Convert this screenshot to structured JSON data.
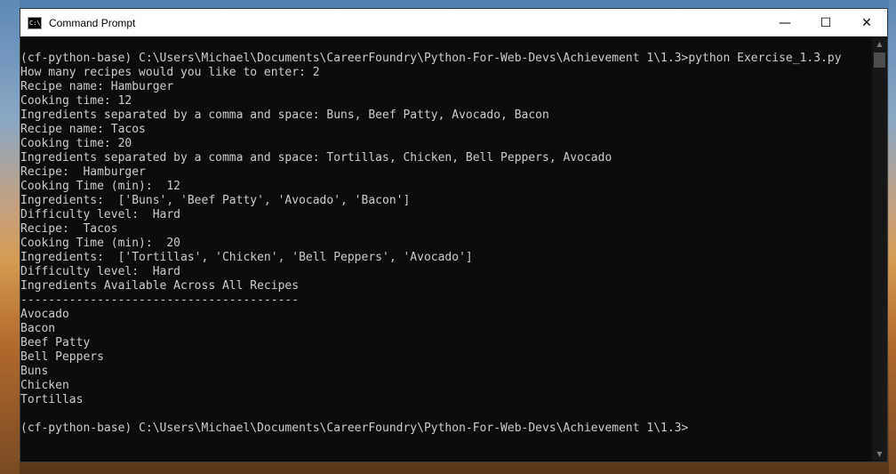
{
  "window": {
    "title": "Command Prompt",
    "icon_text": "C:\\",
    "icon": "console-app-icon",
    "controls": {
      "minimize": "—",
      "maximize": "☐",
      "close": "✕"
    }
  },
  "console": {
    "lines": [
      "(cf-python-base) C:\\Users\\Michael\\Documents\\CareerFoundry\\Python-For-Web-Devs\\Achievement 1\\1.3>python Exercise_1.3.py",
      "How many recipes would you like to enter: 2",
      "Recipe name: Hamburger",
      "Cooking time: 12",
      "Ingredients separated by a comma and space: Buns, Beef Patty, Avocado, Bacon",
      "Recipe name: Tacos",
      "Cooking time: 20",
      "Ingredients separated by a comma and space: Tortillas, Chicken, Bell Peppers, Avocado",
      "Recipe:  Hamburger",
      "Cooking Time (min):  12",
      "Ingredients:  ['Buns', 'Beef Patty', 'Avocado', 'Bacon']",
      "Difficulty level:  Hard",
      "Recipe:  Tacos",
      "Cooking Time (min):  20",
      "Ingredients:  ['Tortillas', 'Chicken', 'Bell Peppers', 'Avocado']",
      "Difficulty level:  Hard",
      "Ingredients Available Across All Recipes",
      "----------------------------------------",
      "Avocado",
      "Bacon",
      "Beef Patty",
      "Bell Peppers",
      "Buns",
      "Chicken",
      "Tortillas",
      "",
      "(cf-python-base) C:\\Users\\Michael\\Documents\\CareerFoundry\\Python-For-Web-Devs\\Achievement 1\\1.3>"
    ]
  },
  "scrollbar": {
    "up_glyph": "▲",
    "down_glyph": "▼"
  },
  "colors": {
    "console_bg": "#0c0c0c",
    "console_text": "#cccccc",
    "titlebar_bg": "#ffffff"
  }
}
